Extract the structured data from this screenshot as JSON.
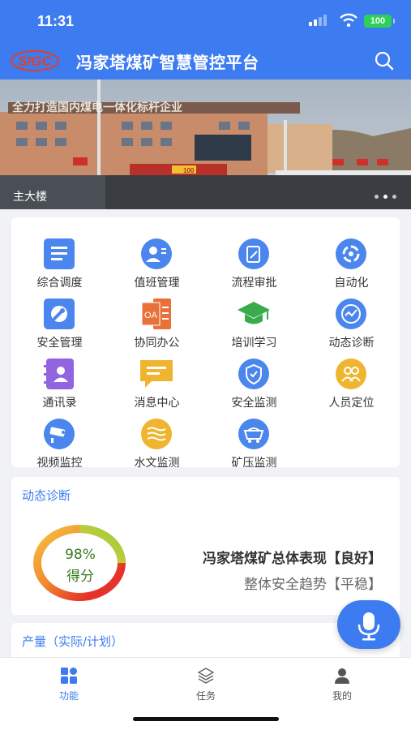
{
  "status": {
    "time": "11:31",
    "battery": "100"
  },
  "header": {
    "logo_text": "SIGC",
    "title": "冯家塔煤矿智慧管控平台"
  },
  "banner": {
    "caption": "主大楼",
    "slogan": "全力打造国内煤电一体化标杆企业",
    "sign_number": "100"
  },
  "grid": [
    {
      "label": "综合调度",
      "icon": "dispatch-icon",
      "color": "#4a86ee"
    },
    {
      "label": "值班管理",
      "icon": "duty-icon",
      "color": "#4a86ee"
    },
    {
      "label": "流程审批",
      "icon": "approval-icon",
      "color": "#4a86ee"
    },
    {
      "label": "自动化",
      "icon": "automation-icon",
      "color": "#4a86ee"
    },
    {
      "label": "安全管理",
      "icon": "wrench-icon",
      "color": "#4a86ee"
    },
    {
      "label": "协同办公",
      "icon": "oa-icon",
      "color": "#e8713a"
    },
    {
      "label": "培训学习",
      "icon": "graduation-icon",
      "color": "#3aab4a"
    },
    {
      "label": "动态诊断",
      "icon": "diagnosis-icon",
      "color": "#4a86ee"
    },
    {
      "label": "通讯录",
      "icon": "contacts-icon",
      "color": "#9364e0"
    },
    {
      "label": "消息中心",
      "icon": "message-icon",
      "color": "#f0b530"
    },
    {
      "label": "安全监测",
      "icon": "shield-icon",
      "color": "#4a86ee"
    },
    {
      "label": "人员定位",
      "icon": "people-icon",
      "color": "#f0b530"
    },
    {
      "label": "视频监控",
      "icon": "camera-icon",
      "color": "#4a86ee"
    },
    {
      "label": "水文监测",
      "icon": "water-icon",
      "color": "#f0b530"
    },
    {
      "label": "矿压监测",
      "icon": "mine-cart-icon",
      "color": "#4a86ee"
    }
  ],
  "diagnosis": {
    "title": "动态诊断",
    "score": "98%",
    "score_label": "得分",
    "score_fraction": 0.98,
    "overall": "冯家塔煤矿总体表现【良好】",
    "trend": "整体安全趋势【平稳】"
  },
  "output": {
    "title": "产量（实际/计划）"
  },
  "tabs": [
    {
      "label": "功能",
      "icon": "grid-icon"
    },
    {
      "label": "任务",
      "icon": "layers-icon"
    },
    {
      "label": "我的",
      "icon": "person-icon"
    }
  ]
}
